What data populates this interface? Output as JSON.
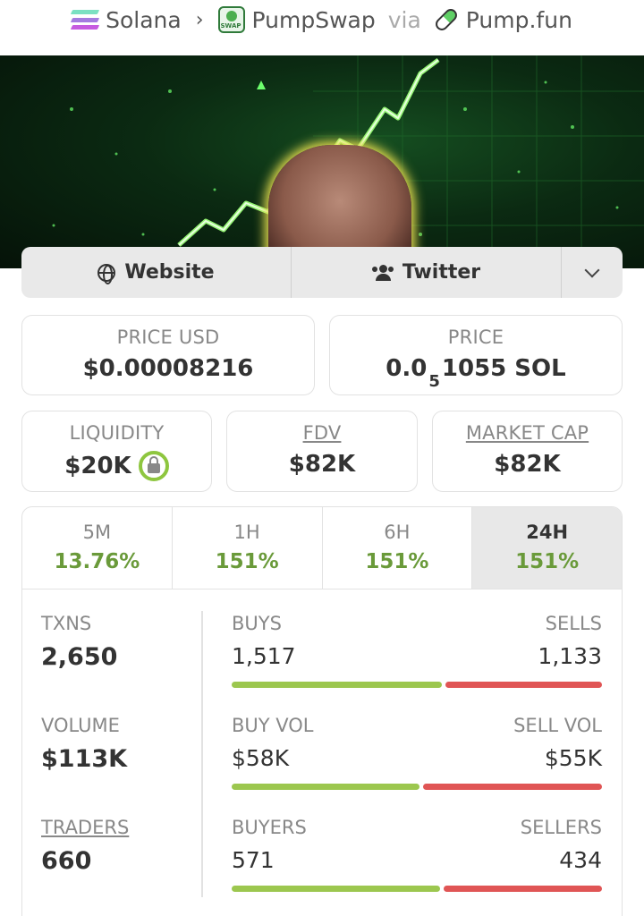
{
  "breadcrumb": {
    "chain": "Solana",
    "dex": "PumpSwap",
    "via": "via",
    "source": "Pump.fun"
  },
  "links": {
    "website": "Website",
    "twitter": "Twitter"
  },
  "price_usd": {
    "label": "PRICE USD",
    "value": "$0.00008216"
  },
  "price_native": {
    "label": "PRICE",
    "prefix": "0.0",
    "subscript": "5",
    "suffix": "1055 SOL"
  },
  "liquidity": {
    "label": "LIQUIDITY",
    "value": "$20K"
  },
  "fdv": {
    "label": "FDV",
    "value": "$82K"
  },
  "market_cap": {
    "label": "MARKET CAP",
    "value": "$82K"
  },
  "timeframes": [
    {
      "label": "5M",
      "change": "13.76%"
    },
    {
      "label": "1H",
      "change": "151%"
    },
    {
      "label": "6H",
      "change": "151%"
    },
    {
      "label": "24H",
      "change": "151%"
    }
  ],
  "stats": {
    "txns": {
      "label": "TXNS",
      "value": "2,650",
      "left_label": "BUYS",
      "left_value": "1,517",
      "right_label": "SELLS",
      "right_value": "1,133",
      "buy_fraction": 0.572
    },
    "volume": {
      "label": "VOLUME",
      "value": "$113K",
      "left_label": "BUY VOL",
      "left_value": "$58K",
      "right_label": "SELL VOL",
      "right_value": "$55K",
      "buy_fraction": 0.513
    },
    "traders": {
      "label": "TRADERS",
      "value": "660",
      "left_label": "BUYERS",
      "left_value": "571",
      "right_label": "SELLERS",
      "right_value": "434",
      "buy_fraction": 0.568
    }
  },
  "colors": {
    "positive": "#6a9a3a",
    "buy_bar": "#9cc74f",
    "sell_bar": "#e05555",
    "lock_ring": "#8ec63f"
  }
}
